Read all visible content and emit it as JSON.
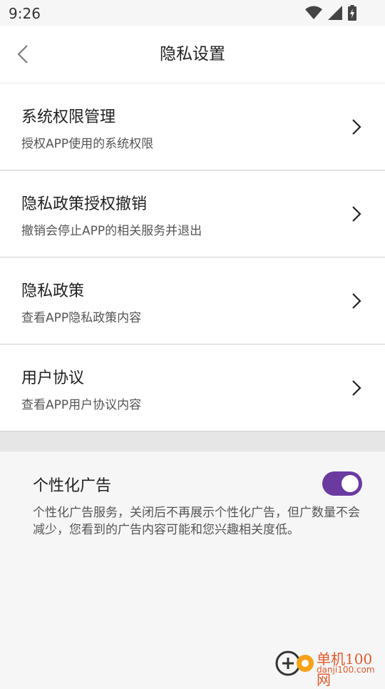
{
  "status_bar": {
    "time": "9:26"
  },
  "nav": {
    "title": "隐私设置"
  },
  "items": [
    {
      "title": "系统权限管理",
      "subtitle": "授权APP使用的系统权限"
    },
    {
      "title": "隐私政策授权撤销",
      "subtitle": "撤销会停止APP的相关服务并退出"
    },
    {
      "title": "隐私政策",
      "subtitle": "查看APP隐私政策内容"
    },
    {
      "title": "用户协议",
      "subtitle": "查看APP用户协议内容"
    }
  ],
  "personalized_ads": {
    "title": "个性化广告",
    "description": "个性化广告服务，关闭后不再展示个性化广告，但广数量不会减少，您看到的广告内容可能和您兴趣相关度低。",
    "enabled": true,
    "toggle_color": "#6a3aa1"
  },
  "watermark": {
    "name": "单机100网",
    "url": "danji100.com"
  },
  "icons": {
    "back": "back-arrow-icon",
    "chevron": "chevron-right-icon",
    "wifi": "wifi-icon",
    "signal": "signal-icon",
    "battery": "battery-charging-icon"
  }
}
